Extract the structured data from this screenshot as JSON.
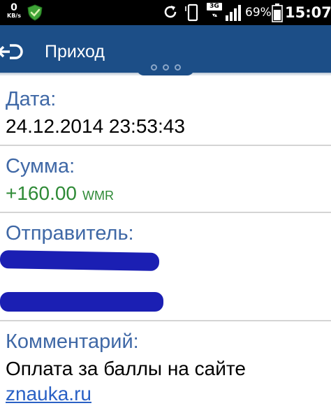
{
  "status_bar": {
    "net_speed_value": "0",
    "net_speed_unit": "KB/s",
    "network_type": "3G",
    "network_activity": "▾▴",
    "battery_percent": "69%",
    "time": "15:07"
  },
  "action_bar": {
    "title": "Приход"
  },
  "details": {
    "date_label": "Дата:",
    "date_value": "24.12.2014 23:53:43",
    "amount_label": "Сумма:",
    "amount_value": "+160.00",
    "amount_currency": "WMR",
    "sender_label": "Отправитель:",
    "comment_label": "Комментарий:",
    "comment_text": "Оплата за баллы на сайте",
    "comment_link": "znauka.ru"
  },
  "colors": {
    "action_bar": "#1c4e87",
    "label": "#3f68a6",
    "amount_positive": "#2e8a36",
    "link": "#2a61c5",
    "redaction": "#1b1fb3"
  }
}
